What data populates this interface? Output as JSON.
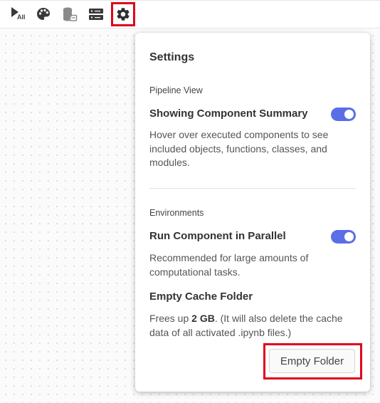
{
  "toolbar": {
    "run_all_label": "All",
    "icons": [
      "run-all-icon",
      "palette-icon",
      "database-icon",
      "server-icon",
      "gear-icon"
    ]
  },
  "settings": {
    "title": "Settings",
    "pipeline_view": {
      "section_title": "Pipeline View",
      "component_summary": {
        "label": "Showing Component Summary",
        "enabled": true,
        "description": "Hover over executed components to see included objects, functions, classes, and modules."
      }
    },
    "environments": {
      "section_title": "Environments",
      "run_parallel": {
        "label": "Run Component in Parallel",
        "enabled": true,
        "description": "Recommended for large amounts of computational tasks."
      },
      "empty_cache": {
        "label": "Empty Cache Folder",
        "description_prefix": "Frees up ",
        "size": "2 GB",
        "description_suffix": ". (It will also delete the cache data of all activated .ipynb files.)",
        "button_label": "Empty Folder"
      }
    }
  },
  "colors": {
    "toggle_on": "#5a6ee6",
    "highlight": "#e0001b"
  }
}
